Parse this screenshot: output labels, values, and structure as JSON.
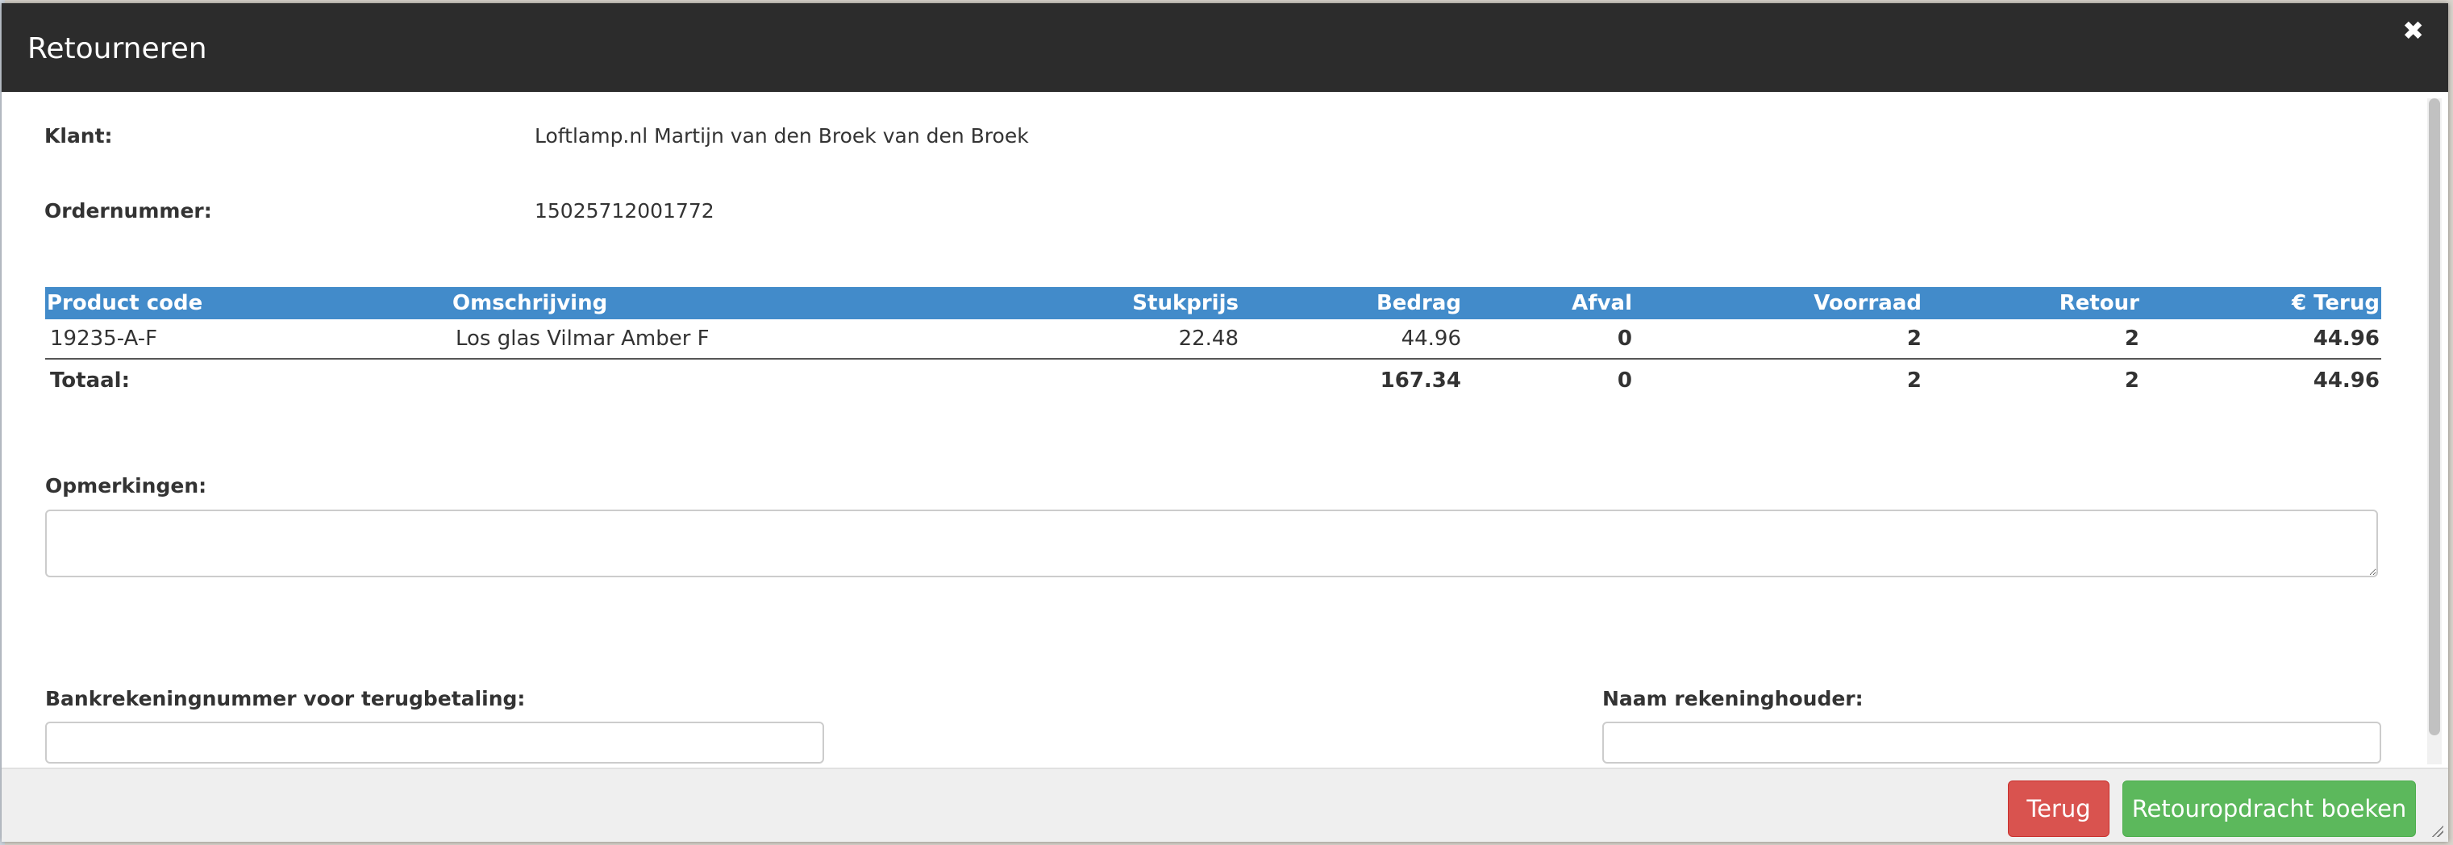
{
  "dialog": {
    "title": "Retourneren",
    "close_icon": "close-icon"
  },
  "info": {
    "customer_label": "Klant:",
    "customer_value": "Loftlamp.nl Martijn van den Broek van den Broek",
    "order_label": "Ordernummer:",
    "order_value": "15025712001772"
  },
  "table": {
    "headers": [
      "Product code",
      "Omschrijving",
      "Stukprijs",
      "Bedrag",
      "Afval",
      "Voorraad",
      "Retour",
      "€ Terug"
    ],
    "rows": [
      {
        "product_code": "19235-A-F",
        "description": "Los glas Vilmar Amber F",
        "unit_price": "22.48",
        "amount": "44.96",
        "waste": "0",
        "stock": "2",
        "return": "2",
        "refund": "44.96"
      }
    ],
    "totals": {
      "label": "Totaal:",
      "amount": "167.34",
      "waste": "0",
      "stock": "2",
      "return": "2",
      "refund": "44.96"
    }
  },
  "remarks": {
    "label": "Opmerkingen:",
    "value": ""
  },
  "bank": {
    "account_label": "Bankrekeningnummer voor terugbetaling:",
    "account_value": "",
    "holder_label": "Naam rekeninghouder:",
    "holder_value": ""
  },
  "footer": {
    "back_label": "Terug",
    "submit_label": "Retouropdracht boeken"
  },
  "colors": {
    "titlebar": "#2c2c2c",
    "table_header": "#428bca",
    "back_button": "#d9534f",
    "submit_button": "#5cb85c"
  }
}
